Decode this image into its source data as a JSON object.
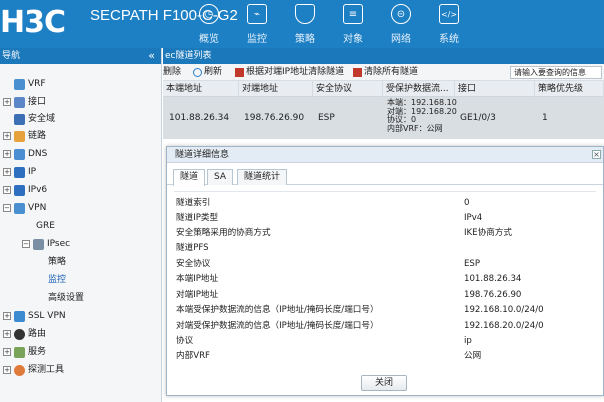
{
  "header": {
    "logo": "H3C",
    "product": "SECPATH F100-C-G2",
    "nav": [
      {
        "label": "概览",
        "icon": "dashboard-icon"
      },
      {
        "label": "监控",
        "icon": "monitor-icon"
      },
      {
        "label": "策略",
        "icon": "shield-icon"
      },
      {
        "label": "对象",
        "icon": "object-icon"
      },
      {
        "label": "网络",
        "icon": "network-icon"
      },
      {
        "label": "系统",
        "icon": "system-icon"
      }
    ]
  },
  "sidebar": {
    "title": "导航",
    "collapse": "«",
    "items": [
      {
        "label": "VRF",
        "icon": "vrf-icon"
      },
      {
        "label": "接口",
        "icon": "interface-icon",
        "expander": "+"
      },
      {
        "label": "安全域",
        "icon": "security-zone-icon"
      },
      {
        "label": "链路",
        "icon": "link-icon",
        "expander": "+"
      },
      {
        "label": "DNS",
        "icon": "dns-icon",
        "expander": "+"
      },
      {
        "label": "IP",
        "icon": "ip-icon",
        "expander": "+"
      },
      {
        "label": "IPv6",
        "icon": "ipv6-icon",
        "expander": "+"
      },
      {
        "label": "VPN",
        "icon": "vpn-icon",
        "expander": "−"
      },
      {
        "label": "GRE"
      },
      {
        "label": "IPsec",
        "icon": "ipsec-icon",
        "expander": "−"
      },
      {
        "label": "策略"
      },
      {
        "label": "监控"
      },
      {
        "label": "高级设置"
      },
      {
        "label": "SSL VPN",
        "icon": "sslvpn-icon",
        "expander": "+"
      },
      {
        "label": "路由",
        "icon": "route-icon",
        "expander": "+"
      },
      {
        "label": "服务",
        "icon": "service-icon",
        "expander": "+"
      },
      {
        "label": "探测工具",
        "icon": "probe-icon",
        "expander": "+"
      }
    ]
  },
  "content": {
    "title": "ec隧道列表",
    "toolbar": {
      "delete": "删除",
      "refresh": "刷新",
      "clear_by_peer": "根据对端IP地址清除隧道",
      "clear_all": "清除所有隧道",
      "search_placeholder": "请输入要查询的信息"
    },
    "columns": [
      "本端地址",
      "对端地址",
      "安全协议",
      "受保护数据流...",
      "接口",
      "策略优先级"
    ],
    "row": {
      "local": "101.88.26.34",
      "peer": "198.76.26.90",
      "protocol": "ESP",
      "flow_lines": [
        "本端：192.168.10",
        "对端：192.168.20",
        "协议：0",
        "内部VRF：公网"
      ],
      "interface": "GE1/0/3",
      "priority": "1"
    }
  },
  "dialog": {
    "title": "隧道详细信息",
    "close_x": "×",
    "tabs": [
      "隧道",
      "SA",
      "隧道统计"
    ],
    "rows": [
      {
        "key": "隧道索引",
        "value": "0"
      },
      {
        "key": "隧道IP类型",
        "value": "IPv4"
      },
      {
        "key": "安全策略采用的协商方式",
        "value": "IKE协商方式"
      },
      {
        "key": "隧道PFS",
        "value": ""
      },
      {
        "key": "安全协议",
        "value": "ESP"
      },
      {
        "key": "本端IP地址",
        "value": "101.88.26.34"
      },
      {
        "key": "对端IP地址",
        "value": "198.76.26.90"
      },
      {
        "key": "本端受保护数据流的信息（IP地址/掩码长度/端口号）",
        "value": "192.168.10.0/24/0"
      },
      {
        "key": "对端受保护数据流的信息（IP地址/掩码长度/端口号）",
        "value": "192.168.20.0/24/0"
      },
      {
        "key": "协议",
        "value": "ip"
      },
      {
        "key": "内部VRF",
        "value": "公网"
      }
    ],
    "close_button": "关闭"
  },
  "colors": {
    "brand": "#1d7fc4",
    "sidebar_head": "#1b78ba",
    "row_selected": "#d9dee3"
  }
}
